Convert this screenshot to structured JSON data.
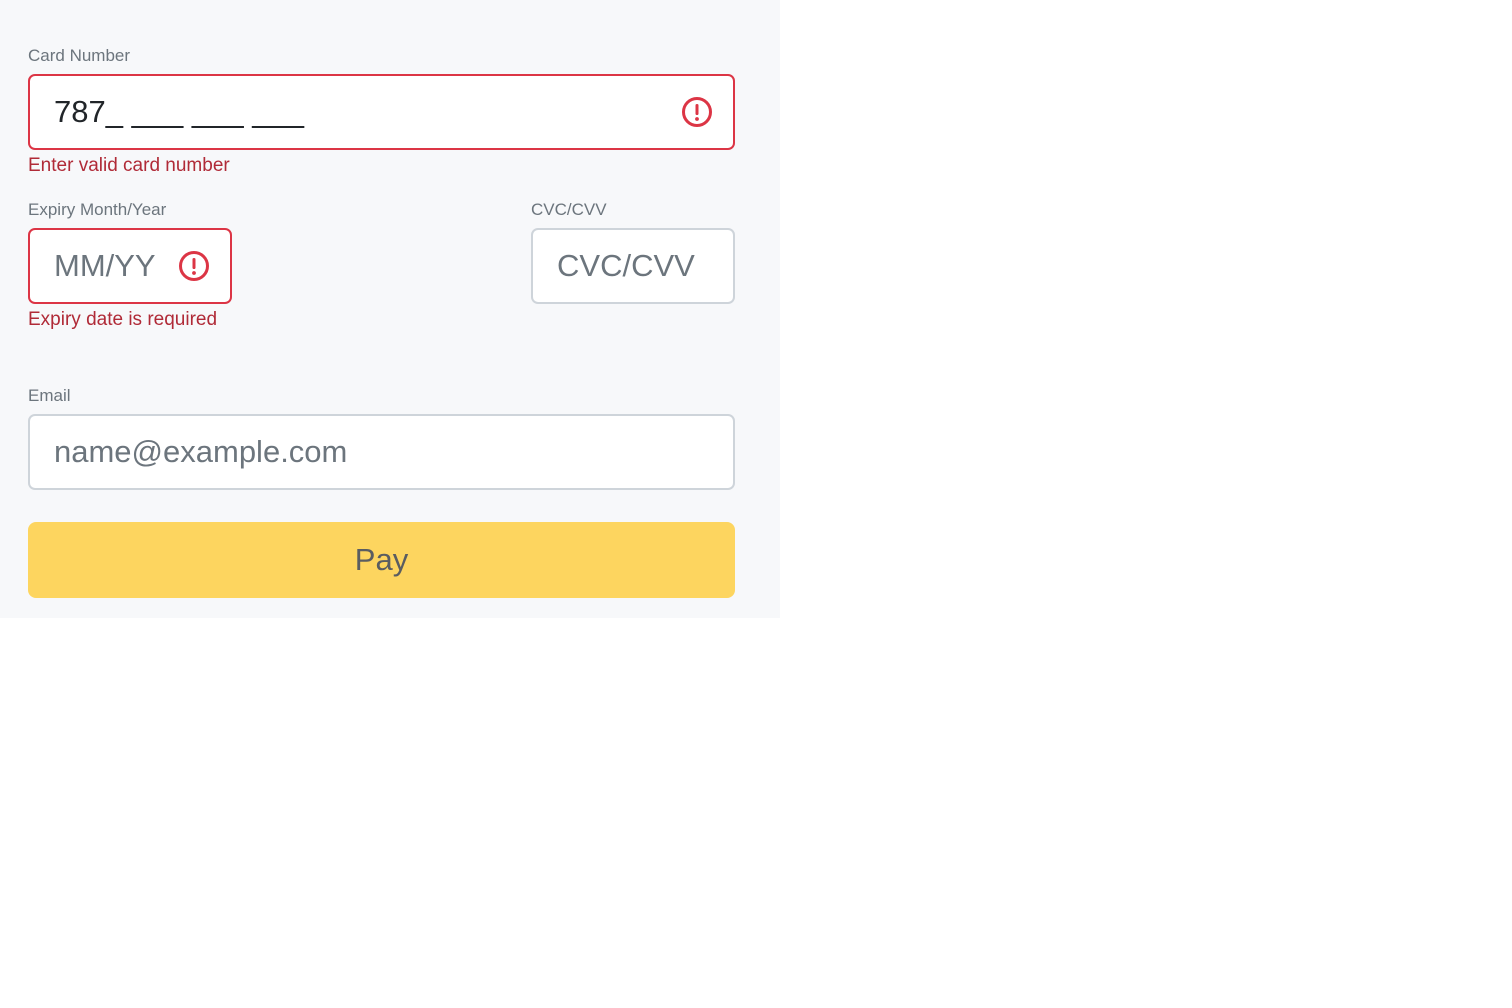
{
  "card": {
    "label": "Card Number",
    "value": "787_ ___ ___ ___",
    "error": "Enter valid card number"
  },
  "expiry": {
    "label": "Expiry Month/Year",
    "placeholder": "MM/YY",
    "value": "",
    "error": "Expiry date is required"
  },
  "cvc": {
    "label": "CVC/CVV",
    "placeholder": "CVC/CVV",
    "value": ""
  },
  "email": {
    "label": "Email",
    "placeholder": "name@example.com",
    "value": ""
  },
  "pay": {
    "label": "Pay"
  },
  "colors": {
    "error": "#dc3545",
    "error_text": "#b02a37",
    "pay_button": "#fdd55f",
    "panel_bg": "#f7f8fa"
  },
  "icons": {
    "field_error": "exclamation-circle-icon"
  }
}
